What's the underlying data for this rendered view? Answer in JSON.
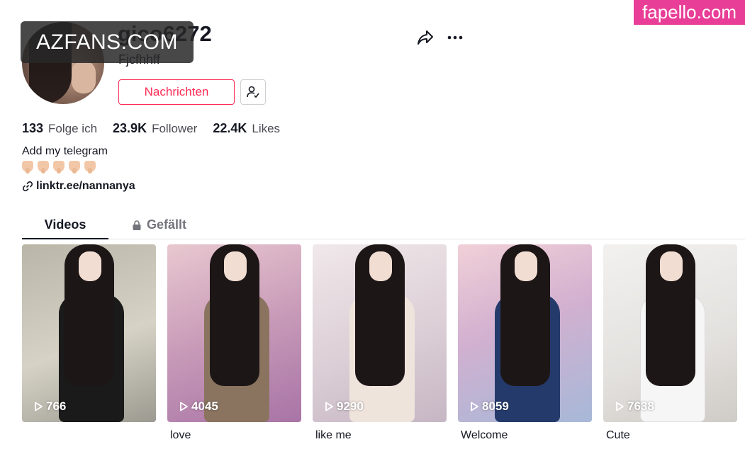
{
  "watermarks": {
    "left": "AZFANS.COM",
    "right": "fapello.com"
  },
  "profile": {
    "username": "gico6272",
    "nickname": "Fjcfhhff",
    "message_button": "Nachrichten"
  },
  "stats": [
    {
      "value": "133",
      "label": "Folge ich"
    },
    {
      "value": "23.9K",
      "label": "Follower"
    },
    {
      "value": "22.4K",
      "label": "Likes"
    }
  ],
  "bio": {
    "text": "Add my telegram",
    "emoji_count": 5,
    "link": "linktr.ee/nannanya"
  },
  "tabs": [
    {
      "label": "Videos",
      "active": true
    },
    {
      "label": "Gefällt",
      "locked": true
    }
  ],
  "videos": [
    {
      "views": "766",
      "caption": "",
      "bg": "#c8c4b8",
      "outfit": "#1a1a1a"
    },
    {
      "views": "4045",
      "caption": "love",
      "bg": "#d9b3c2",
      "outfit": "#8a7460"
    },
    {
      "views": "9290",
      "caption": "like me",
      "bg": "#e6dde0",
      "outfit": "#efe4dc"
    },
    {
      "views": "8059",
      "caption": "Welcome",
      "bg": "#d9c2cf",
      "outfit": "#243a6b"
    },
    {
      "views": "7638",
      "caption": "Cute",
      "bg": "#ecebea",
      "outfit": "#f6f6f6"
    }
  ]
}
